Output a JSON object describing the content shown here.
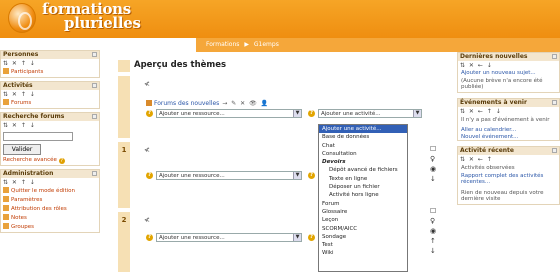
{
  "header": {
    "logo_line1": "formations",
    "logo_line2": "plurielles"
  },
  "breadcrumb": {
    "items": [
      "Formations",
      "▶",
      "G1emps"
    ]
  },
  "left": {
    "people": {
      "title": "Personnes",
      "controls": "⇅ ✕ ↑ ↓",
      "link": "Participants"
    },
    "activities": {
      "title": "Activités",
      "controls": "⇅ ✕ ↑ ↓",
      "link": "Forums"
    },
    "search": {
      "title": "Recherche forums",
      "controls": "⇅ ✕ ↑ ↓",
      "button": "Valider",
      "advanced": "Recherche avancée"
    },
    "admin": {
      "title": "Administration",
      "controls": "⇅ ✕ ↑ ↓",
      "links": [
        "Quitter le mode édition",
        "Paramètres",
        "Attribution des rôles",
        "Notes",
        "Groupes"
      ]
    }
  },
  "main": {
    "title": "Aperçu des thèmes",
    "forum_link": "Forums des nouvelles",
    "forum_tools": "→ ✎ ✕ 👁 👤",
    "add_resource": "Ajouter une ressource...",
    "add_activity": "Ajouter une activité...",
    "section_numbers": [
      "1",
      "2"
    ]
  },
  "dropdown": {
    "items": [
      {
        "label": "Ajouter une activité...",
        "type": "selected"
      },
      {
        "label": "Base de données",
        "type": "item"
      },
      {
        "label": "Chat",
        "type": "item"
      },
      {
        "label": "Consultation",
        "type": "item"
      },
      {
        "label": "Devoirs",
        "type": "group"
      },
      {
        "label": "Dépôt avancé de fichiers",
        "type": "sub"
      },
      {
        "label": "Texte en ligne",
        "type": "sub"
      },
      {
        "label": "Déposer un fichier",
        "type": "sub"
      },
      {
        "label": "Activité hors ligne",
        "type": "sub"
      },
      {
        "label": "Forum",
        "type": "item"
      },
      {
        "label": "Glossaire",
        "type": "item"
      },
      {
        "label": "Leçon",
        "type": "item"
      },
      {
        "label": "SCORM/AICC",
        "type": "item"
      },
      {
        "label": "Sondage",
        "type": "item"
      },
      {
        "label": "Test",
        "type": "item"
      },
      {
        "label": "Wiki",
        "type": "item"
      }
    ]
  },
  "right": {
    "news": {
      "title": "Dernières nouvelles",
      "controls": "⇅ ✕ ← ↓",
      "link": "Ajouter un nouveau sujet...",
      "text": "(Aucune brève n'a encore été publiée)"
    },
    "events": {
      "title": "Événements à venir",
      "controls": "⇅ ✕ ← ↑ ↓",
      "text": "Il n'y a pas d'événement à venir",
      "links": [
        "Aller au calendrier...",
        "Nouvel événement..."
      ]
    },
    "recent": {
      "title": "Activité récente",
      "controls": "⇅ ✕ ← ↑",
      "text1": "Activités observées",
      "text2": "Rapport complet des activités récentes...",
      "text3": "Rien de nouveau depuis votre dernière visite"
    }
  },
  "colors": {
    "header": "#f39a1c",
    "section_strip": "#f6e0b4",
    "selected": "#3260b6",
    "link": "#2a56a8",
    "left_link": "#c03a00"
  }
}
